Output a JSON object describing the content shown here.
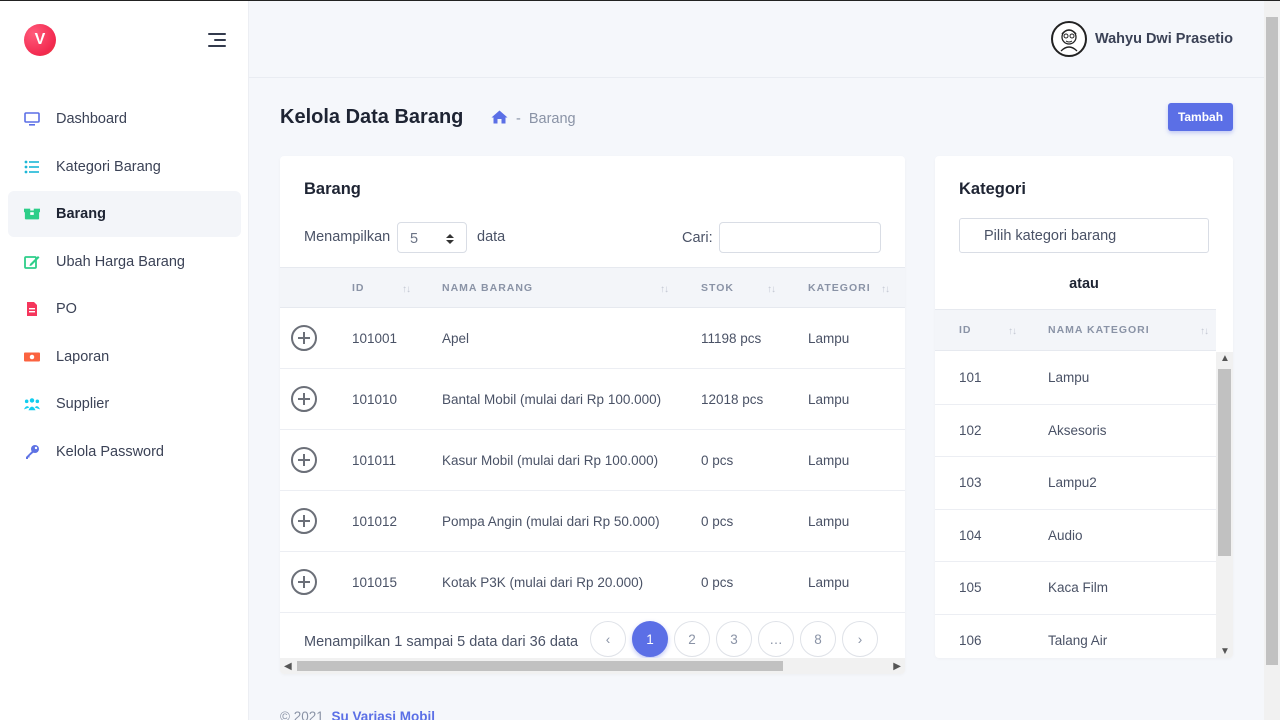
{
  "brand": {
    "logo_letter": "V"
  },
  "sidebar": {
    "items": [
      {
        "label": "Dashboard",
        "icon": "monitor-icon",
        "color": "#5b6fe6"
      },
      {
        "label": "Kategori Barang",
        "icon": "list-icon",
        "color": "#1cb7d6"
      },
      {
        "label": "Barang",
        "icon": "box-icon",
        "color": "#2dce89",
        "active": true
      },
      {
        "label": "Ubah Harga Barang",
        "icon": "edit-icon",
        "color": "#2dce89"
      },
      {
        "label": "PO",
        "icon": "document-icon",
        "color": "#f5365c"
      },
      {
        "label": "Laporan",
        "icon": "money-icon",
        "color": "#fb6340"
      },
      {
        "label": "Supplier",
        "icon": "users-icon",
        "color": "#11cdef"
      },
      {
        "label": "Kelola Password",
        "icon": "key-icon",
        "color": "#5e72e4"
      }
    ]
  },
  "header": {
    "user_name": "Wahyu Dwi Prasetio"
  },
  "page": {
    "title": "Kelola Data Barang",
    "breadcrumb_sep": "-",
    "breadcrumb": "Barang",
    "add_button": "Tambah"
  },
  "barang": {
    "title": "Barang",
    "show_label": "Menampilkan",
    "page_size": "5",
    "data_label": "data",
    "search_label": "Cari:",
    "columns": [
      "ID",
      "NAMA BARANG",
      "STOK",
      "KATEGORI"
    ],
    "rows": [
      {
        "id": "101001",
        "name": "Apel",
        "stok": "11198 pcs",
        "kategori": "Lampu"
      },
      {
        "id": "101010",
        "name": "Bantal Mobil (mulai dari Rp 100.000)",
        "stok": "12018 pcs",
        "kategori": "Lampu"
      },
      {
        "id": "101011",
        "name": "Kasur Mobil (mulai dari Rp 100.000)",
        "stok": "0 pcs",
        "kategori": "Lampu"
      },
      {
        "id": "101012",
        "name": "Pompa Angin (mulai dari Rp 50.000)",
        "stok": "0 pcs",
        "kategori": "Lampu"
      },
      {
        "id": "101015",
        "name": "Kotak P3K (mulai dari Rp 20.000)",
        "stok": "0 pcs",
        "kategori": "Lampu"
      }
    ],
    "info": "Menampilkan 1 sampai 5 data dari 36 data",
    "pagination": {
      "prev": "‹",
      "pages": [
        "1",
        "2",
        "3",
        "…",
        "8"
      ],
      "next": "›",
      "current": "1"
    }
  },
  "kategori": {
    "title": "Kategori",
    "select_placeholder": "Pilih kategori barang",
    "or_label": "atau",
    "columns": [
      "ID",
      "NAMA KATEGORI"
    ],
    "rows": [
      {
        "id": "101",
        "name": "Lampu"
      },
      {
        "id": "102",
        "name": "Aksesoris"
      },
      {
        "id": "103",
        "name": "Lampu2"
      },
      {
        "id": "104",
        "name": "Audio"
      },
      {
        "id": "105",
        "name": "Kaca Film"
      },
      {
        "id": "106",
        "name": "Talang Air"
      }
    ]
  },
  "footer": {
    "copyright": "© 2021",
    "brand": "Su Variasi Mobil"
  }
}
